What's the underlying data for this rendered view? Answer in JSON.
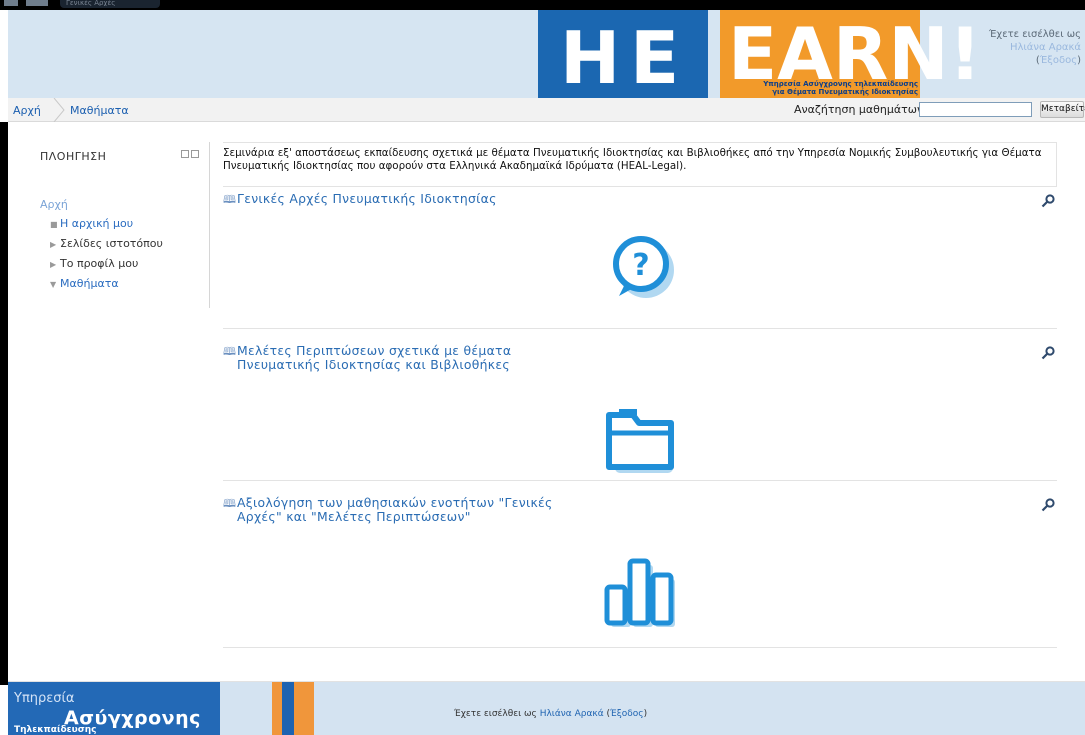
{
  "browser": {
    "tab_title": "Γενικές Αρχές"
  },
  "header": {
    "logo_tagline_1": "Υπηρεσία Ασύγχρονης τηλεκπαίδευσης",
    "logo_tagline_2": "για Θέματα Πνευματικής Ιδιοκτησίας",
    "login_label": "Έχετε εισέλθει ως",
    "user_name": "Ηλιάνα Αρακά",
    "logout_label": "Έξοδος"
  },
  "breadcrumb": {
    "home": "Αρχή",
    "courses": "Μαθήματα"
  },
  "search": {
    "label": "Αναζήτηση μαθημάτων:",
    "placeholder": "",
    "value": "",
    "button": "Μεταβείτε"
  },
  "sidebar": {
    "title": "ΠΛΟΗΓΗΣΗ",
    "root": "Αρχή",
    "items": [
      {
        "label": "Η αρχική μου",
        "marker": "■"
      },
      {
        "label": "Σελίδες ιστοτόπου",
        "marker": "▶"
      },
      {
        "label": "Το προφίλ μου",
        "marker": "▶"
      },
      {
        "label": "Μαθήματα",
        "marker": "▼"
      }
    ]
  },
  "course": {
    "summary_line1": "Σεμινάρια εξ' αποστάσεως εκπαίδευσης σχετικά με θέματα Πνευματικής Ιδιοκτησίας και Βιβλιοθήκες από την Υπηρεσία Νομικής Συμβουλευτικής για Θέματα",
    "summary_line2": "Πνευματικής Ιδιοκτησίας που αφορούν στα Ελληνικά Ακαδημαϊκά Ιδρύματα (HEAL-Legal).",
    "sections": [
      {
        "line1": "Γενικές Αρχές Πνευματικής Ιδιοκτησίας",
        "line2": "",
        "icon": "question-bubble-icon"
      },
      {
        "line1": "Μελέτες Περιπτώσεων σχετικά με θέματα",
        "line2": "Πνευματικής Ιδιοκτησίας και Βιβλιοθήκες",
        "icon": "folder-icon"
      },
      {
        "line1": "Αξιολόγηση των μαθησιακών ενοτήτων \"Γενικές",
        "line2": "Αρχές\" και \"Μελέτες Περιπτώσεων\"",
        "icon": "bar-chart-icon"
      }
    ]
  },
  "footer": {
    "logo_line1": "Υπηρεσία",
    "logo_line2": "Ασύγχρονης",
    "logo_line3": "Τηλεκπαίδευσης",
    "login_label": "Έχετε εισέλθει ως",
    "user_name": "Ηλιάνα Αρακά",
    "logout_label": "Έξοδος"
  },
  "colors": {
    "accent_blue": "#2a6cb3",
    "icon_blue": "#1f8fd8",
    "brand_orange": "#f29a2a",
    "header_bg": "#d6e5f2"
  }
}
